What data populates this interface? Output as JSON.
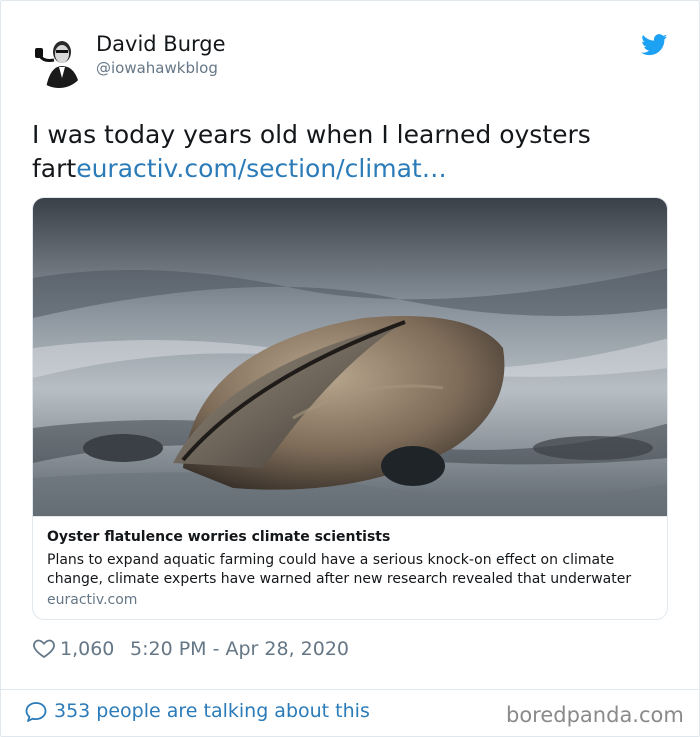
{
  "author": {
    "name": "David Burge",
    "handle": "@iowahawkblog",
    "avatar_icon": "avatar-portrait-with-pipe"
  },
  "brand": {
    "icon": "twitter-bird-icon",
    "color": "#1da1f2"
  },
  "tweet": {
    "text": "I was today years old when I learned oysters fart",
    "link_text": "euractiv.com/section/climat…",
    "link_color": "#2b7bb9"
  },
  "card": {
    "image_description_icon": "oyster-photo",
    "title": "Oyster flatulence worries climate scientists",
    "description": "Plans to expand aquatic farming could have a serious knock-on effect on climate change, climate experts have warned after new research revealed that underwater",
    "domain": "euractiv.com"
  },
  "meta": {
    "likes": "1,060",
    "timestamp": "5:20 PM - Apr 28, 2020",
    "heart_icon": "heart-icon"
  },
  "footer": {
    "talking": "353 people are talking about this",
    "bubble_icon": "speech-bubble-icon"
  },
  "watermark": "boredpanda.com",
  "colors": {
    "text": "#14171a",
    "muted": "#657786",
    "border": "#e1e8ed"
  }
}
